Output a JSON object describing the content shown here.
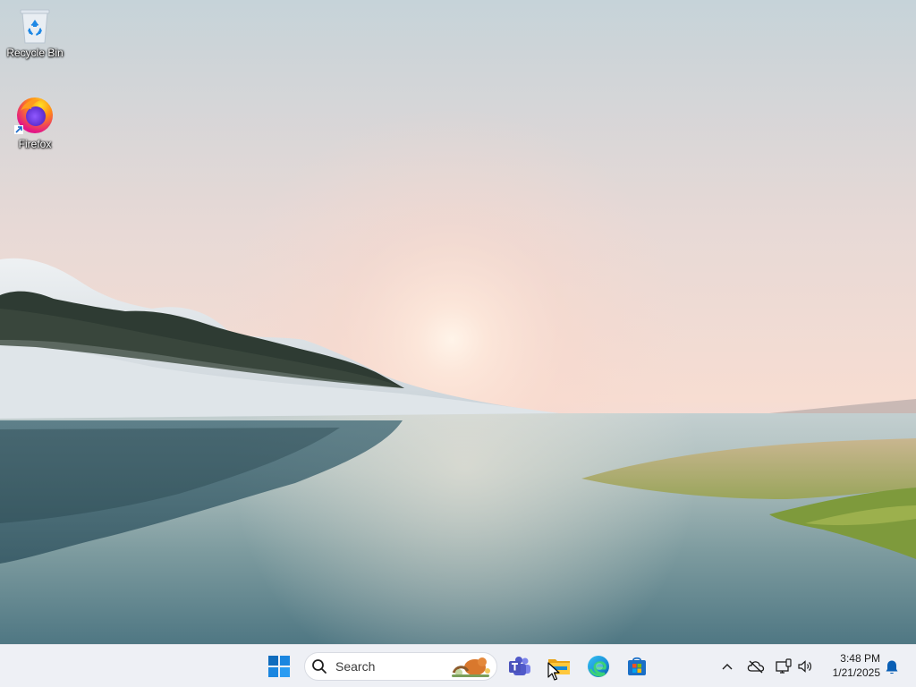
{
  "desktop": {
    "icons": [
      {
        "label": "Recycle Bin",
        "icon": "recycle-bin-icon"
      },
      {
        "label": "Firefox",
        "icon": "firefox-icon",
        "shortcut": true
      }
    ]
  },
  "taskbar": {
    "start_icon": "windows-start-icon",
    "search": {
      "placeholder": "Search",
      "icon": "search-icon"
    },
    "pinned_apps": [
      {
        "name": "Microsoft Teams",
        "icon": "teams-icon"
      },
      {
        "name": "File Explorer",
        "icon": "file-explorer-icon"
      },
      {
        "name": "Microsoft Edge",
        "icon": "edge-icon"
      },
      {
        "name": "Microsoft Store",
        "icon": "store-icon"
      }
    ],
    "tray": {
      "icons": [
        "chevron-up-icon",
        "onedrive-offline-icon",
        "network-icon",
        "volume-icon",
        "notification-bell-icon"
      ],
      "time": "3:48 PM",
      "date": "1/21/2025"
    }
  },
  "colors": {
    "taskbar_bg": "#eef0f5",
    "accent": "#0067c0",
    "sky_top": "#c6d3d9",
    "sky_glow": "#f8d9cb"
  }
}
